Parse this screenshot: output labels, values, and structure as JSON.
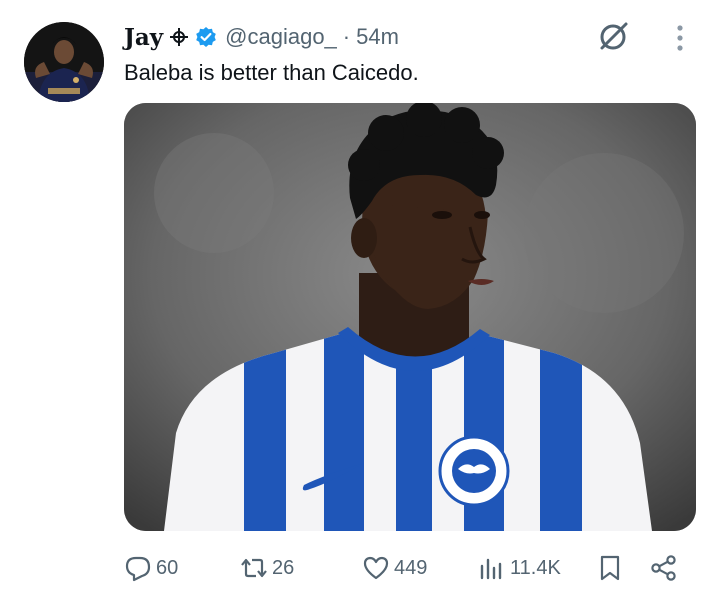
{
  "tweet": {
    "author": {
      "name": "Jay",
      "handle": "@cagiago_",
      "separator": "·",
      "time": "54m",
      "avatar_icon": "user-avatar",
      "symbol_icon": "crosshair-symbol-icon",
      "verified_icon": "verified-badge-icon"
    },
    "text": "Baleba is better than Caicedo.",
    "media": {
      "kind": "photo",
      "subject": "football player in blue and white striped jersey"
    },
    "actions": {
      "replies": "60",
      "reposts": "26",
      "likes": "449",
      "views": "11.4K"
    }
  },
  "colors": {
    "text": "#0f1419",
    "muted": "#536471",
    "verified": "#1d9bf0",
    "jersey_blue": "#1f56b8"
  }
}
